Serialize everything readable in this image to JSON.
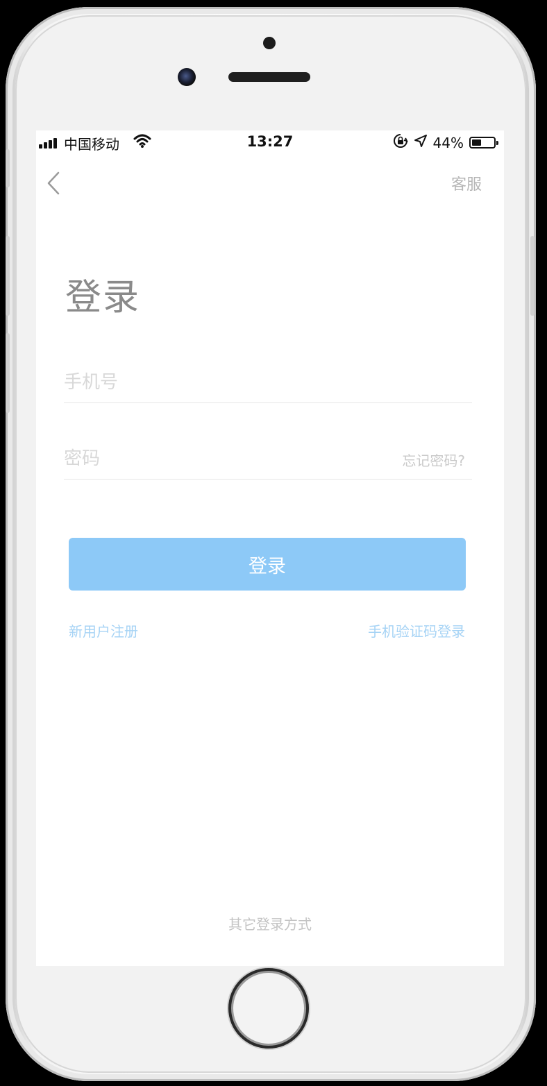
{
  "status_bar": {
    "carrier": "中国移动",
    "time": "13:27",
    "battery_percent": "44%",
    "battery_level": 0.44,
    "icons": [
      "signal-icon",
      "wifi-icon",
      "rotation-lock-icon",
      "location-icon",
      "battery-icon"
    ]
  },
  "nav": {
    "back_icon": "chevron-left-icon",
    "service_label": "客服"
  },
  "page": {
    "title": "登录"
  },
  "form": {
    "phone_placeholder": "手机号",
    "phone_value": "",
    "password_placeholder": "密码",
    "password_value": "",
    "forgot_label": "忘记密码?",
    "login_label": "登录"
  },
  "links": {
    "register_label": "新用户注册",
    "sms_login_label": "手机验证码登录",
    "other_login_label": "其它登录方式"
  },
  "colors": {
    "primary_button": "#8dc9f7",
    "link": "#a6d3f5",
    "title": "#8a8a8a"
  }
}
